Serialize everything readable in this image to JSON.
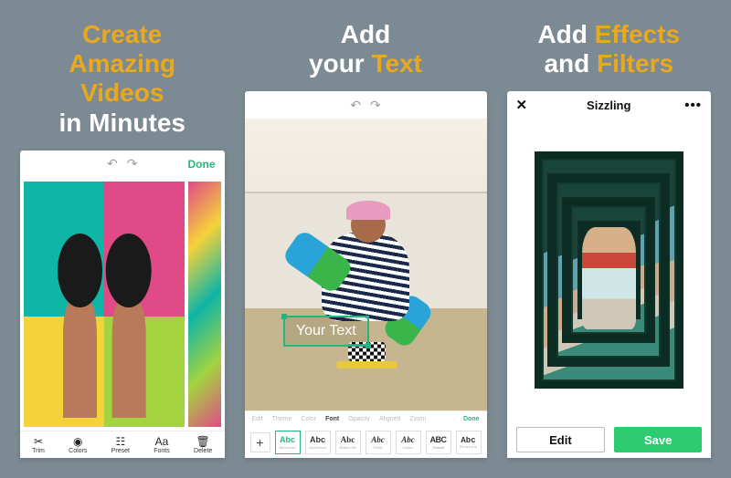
{
  "panel1": {
    "headline": {
      "l1a": "Create",
      "l1b": "Amazing",
      "l1c": "Videos",
      "l2": "in Minutes"
    },
    "topbar_done": "Done",
    "tools": [
      {
        "name": "trim",
        "icon": "✂",
        "label": "Trim"
      },
      {
        "name": "colors",
        "icon": "◉",
        "label": "Colors"
      },
      {
        "name": "preset",
        "icon": "☷",
        "label": "Preset"
      },
      {
        "name": "fonts",
        "icon": "Aa",
        "label": "Fonts"
      },
      {
        "name": "delete",
        "icon": "🗑",
        "label": "Delete"
      }
    ]
  },
  "panel2": {
    "headline": {
      "l1": "Add",
      "l2a": "your ",
      "l2b": "Text"
    },
    "topbar_done": "Done",
    "text_box": "Your Text",
    "tabs": {
      "edit": "Edit",
      "theme": "Theme",
      "color": "Color",
      "font": "Font",
      "opacity": "Opacity",
      "aligned": "Aligned",
      "zoom": "Zoom"
    },
    "selected_tab": "font",
    "add_font_icon": "+",
    "fonts": [
      {
        "sample": "Abc",
        "name": "NexaLean",
        "selected": true,
        "cls": ""
      },
      {
        "sample": "Abc",
        "name": "OpenSans",
        "selected": false,
        "cls": ""
      },
      {
        "sample": "Abc",
        "name": "Baskerville",
        "selected": false,
        "cls": "ff-serif"
      },
      {
        "sample": "Abc",
        "name": "Nobile",
        "selected": false,
        "cls": "ff-italic"
      },
      {
        "sample": "Abc",
        "name": "Lobster",
        "selected": false,
        "cls": "ff-italic"
      },
      {
        "sample": "ABC",
        "name": "Rockwell",
        "selected": false,
        "cls": "ff-cond"
      },
      {
        "sample": "Abc",
        "name": "Palatino",
        "selected": false,
        "cls": "ff-mono"
      }
    ]
  },
  "panel3": {
    "headline": {
      "l1a": "Add ",
      "l1b": "Effects",
      "l2a": "and ",
      "l2b": "Filters"
    },
    "title": "Sizzling",
    "edit": "Edit",
    "save": "Save"
  }
}
